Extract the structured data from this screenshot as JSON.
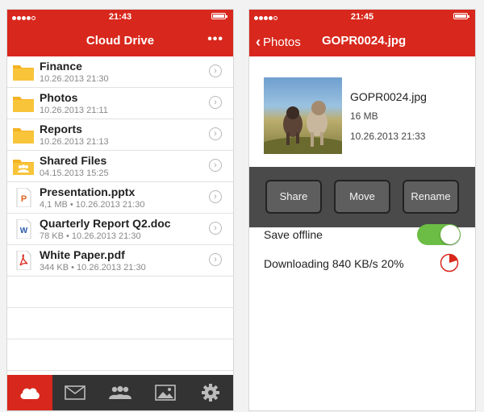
{
  "colors": {
    "accent": "#d8271c",
    "toggle_on": "#6cbd45",
    "tabbar": "#333333"
  },
  "left": {
    "status": {
      "time": "21:43"
    },
    "nav": {
      "title": "Cloud Drive",
      "more": "•••"
    },
    "files": [
      {
        "name": "Finance",
        "meta": "10.26.2013 21:30",
        "icon": "folder-icon"
      },
      {
        "name": "Photos",
        "meta": "10.26.2013 21:11",
        "icon": "folder-icon"
      },
      {
        "name": "Reports",
        "meta": "10.26.2013 21:13",
        "icon": "folder-icon"
      },
      {
        "name": "Shared Files",
        "meta": "04.15.2013 15:25",
        "icon": "shared-folder-icon"
      },
      {
        "name": "Presentation.pptx",
        "meta": "4,1 MB • 10.26.2013 21:30",
        "icon": "pptx-file-icon"
      },
      {
        "name": "Quarterly Report Q2.doc",
        "meta": "78 KB • 10.26.2013 21:30",
        "icon": "doc-file-icon"
      },
      {
        "name": "White Paper.pdf",
        "meta": "344 KB • 10.26.2013 21:30",
        "icon": "pdf-file-icon"
      }
    ],
    "tabs": [
      "cloud-icon",
      "mail-icon",
      "contacts-icon",
      "photos-icon",
      "settings-gear-icon"
    ]
  },
  "right": {
    "status": {
      "time": "21:45"
    },
    "nav": {
      "back_label": "Photos",
      "title": "GOPR0024.jpg"
    },
    "file": {
      "name": "GOPR0024.jpg",
      "size": "16 MB",
      "date": "10.26.2013 21:33"
    },
    "actions": {
      "share": "Share",
      "move": "Move",
      "rename": "Rename"
    },
    "save_offline": {
      "label": "Save offline",
      "on": true
    },
    "download": {
      "label": "Downloading 840 KB/s 20%",
      "progress": 0.2
    }
  }
}
